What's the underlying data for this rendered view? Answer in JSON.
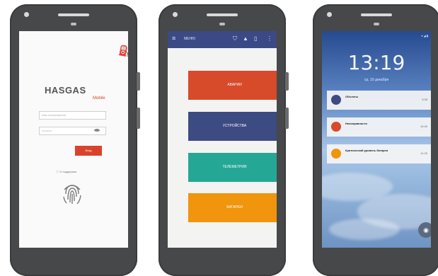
{
  "phone1": {
    "brand": "HASGAS",
    "brand_sub": "Mobile",
    "username_placeholder": "Имя пользователя",
    "password_value": "••••••••••",
    "login_label": "Вход",
    "support_label": "О поддержке"
  },
  "phone2": {
    "menu_label": "МЕНЮ",
    "tiles": [
      "АВАРИИ",
      "УСТРОЙСТВА",
      "ТЕЛЕМЕТРИЯ",
      "БАТАРЕИ"
    ],
    "colors": {
      "appbar": "#3b4a86",
      "tile1": "#d74a2a",
      "tile2": "#3d4b83",
      "tile3": "#25a796",
      "tile4": "#f0950c"
    }
  },
  "phone3": {
    "clock": "13:19",
    "date": "ср, 10 декабря",
    "notifications": [
      {
        "title": "Объекты",
        "subtitle": "",
        "time": "9:38"
      },
      {
        "title": "Неисправности",
        "subtitle": "",
        "time": "10:45"
      },
      {
        "title": "Критический уровень батареи",
        "subtitle": "",
        "time": "11:25"
      }
    ]
  }
}
